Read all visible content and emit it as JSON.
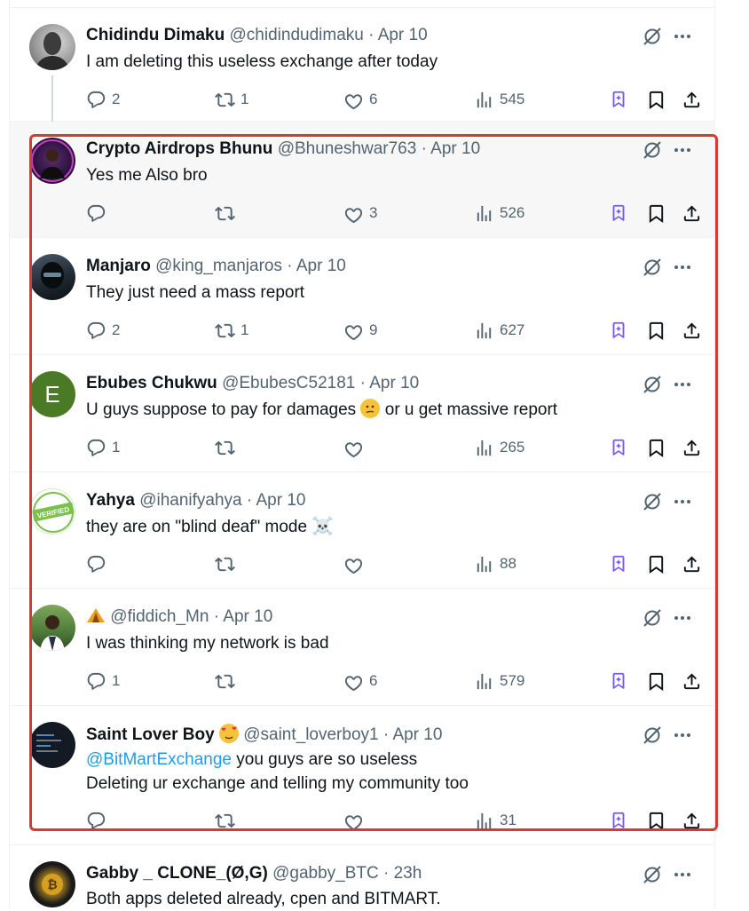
{
  "tweets": [
    {
      "name": "Chidindu Dimaku",
      "handle": "@chidindudimaku",
      "dot": "·",
      "date": "Apr 10",
      "text": "I am deleting this useless exchange after today",
      "replies": "2",
      "reposts": "1",
      "likes": "6",
      "views": "545"
    },
    {
      "name": "Crypto Airdrops Bhunu",
      "handle": "@Bhuneshwar763",
      "dot": "·",
      "date": "Apr 10",
      "text": "Yes me Also bro",
      "replies": "",
      "reposts": "",
      "likes": "3",
      "views": "526"
    },
    {
      "name": "Manjaro",
      "handle": "@king_manjaros",
      "dot": "·",
      "date": "Apr 10",
      "text": "They just need a mass report",
      "replies": "2",
      "reposts": "1",
      "likes": "9",
      "views": "627"
    },
    {
      "name": "Ebubes Chukwu",
      "handle": "@EbubesC52181",
      "dot": "·",
      "date": "Apr 10",
      "text_before": "U guys suppose to pay for damages",
      "text_after": "or u get massive report",
      "replies": "1",
      "reposts": "",
      "likes": "",
      "views": "265",
      "avatar_letter": "E"
    },
    {
      "name": "Yahya",
      "handle": "@ihanifyahya",
      "dot": "·",
      "date": "Apr 10",
      "text": "they are on \"blind deaf\" mode",
      "replies": "",
      "reposts": "",
      "likes": "",
      "views": "88",
      "avatar_text": "VERIFIED"
    },
    {
      "name": "",
      "handle": "@fiddich_Mn",
      "dot": "·",
      "date": "Apr 10",
      "text": "I was thinking my network is bad",
      "replies": "1",
      "reposts": "",
      "likes": "6",
      "views": "579"
    },
    {
      "name": "Saint Lover Boy",
      "handle": "@saint_loverboy1",
      "dot": "·",
      "date": "Apr 10",
      "mention": "@BitMartExchange",
      "text_line1": "you guys are so useless",
      "text_line2": "Deleting ur exchange and telling my community too",
      "replies": "",
      "reposts": "",
      "likes": "",
      "views": "31"
    },
    {
      "name": "Gabby _ CLONE_(Ø,G)",
      "handle": "@gabby_BTC",
      "dot": "·",
      "date": "23h",
      "text": "Both apps deleted already, cpen and BITMART."
    }
  ],
  "icons": {
    "reply": "reply-icon",
    "repost": "repost-icon",
    "like": "like-icon",
    "views": "views-icon",
    "grok": "grok-icon",
    "bookmark": "bookmark-icon",
    "share": "share-icon",
    "more": "more-icon"
  },
  "colors": {
    "accent_purple": "#7856ff",
    "mention": "#1d9bf0",
    "highlight_border": "#d93a30",
    "muted": "#536471"
  }
}
